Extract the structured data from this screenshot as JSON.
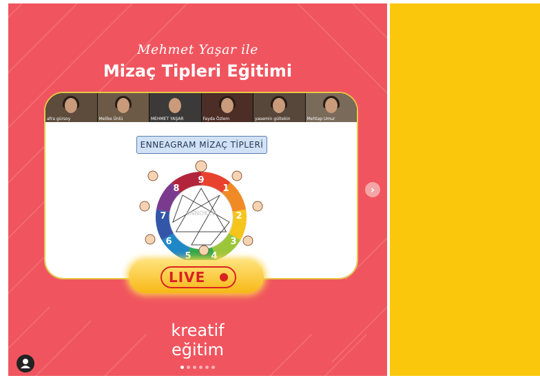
{
  "post": {
    "script_title": "Mehmet Yaşar ile",
    "main_title": "Mizaç Tipleri Eğitimi",
    "brand_line1": "kreatif",
    "brand_line2": "eğitim",
    "live_label": "LIVE",
    "watermark": "ENNOKEB"
  },
  "participants": [
    {
      "name": "afra gürsoy"
    },
    {
      "name": "Melike Ünlü"
    },
    {
      "name": "MEHMET YAŞAR"
    },
    {
      "name": "Fayda Özlem"
    },
    {
      "name": "yasemin gültekin"
    },
    {
      "name": "Mehtap Umur"
    }
  ],
  "slide": {
    "title": "ENNEAGRAM MİZAÇ TİPLERİ",
    "numbers": [
      "9",
      "1",
      "2",
      "3",
      "4",
      "5",
      "6",
      "7",
      "8"
    ]
  },
  "carousel": {
    "slides": 6,
    "active": 0
  },
  "colors": {
    "post_bg": "#f0555f",
    "right_panel": "#fbc70c",
    "live_red": "#d92121",
    "live_gold": "#f7b816"
  },
  "icons": {
    "next": "chevron-right-icon",
    "profile": "user-icon"
  }
}
